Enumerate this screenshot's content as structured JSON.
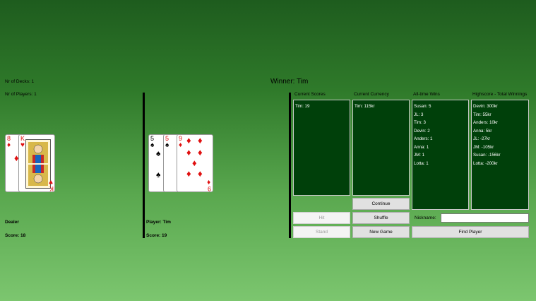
{
  "info": {
    "decks": "Nr of Decks: 1",
    "players": "Nr of Players: 1"
  },
  "winner": "Winner: Tim",
  "dealer": {
    "name": "Dealer",
    "score": "Score: 18",
    "cards": [
      {
        "rank": "8",
        "suit": "diamonds"
      },
      {
        "rank": "K",
        "suit": "hearts"
      }
    ]
  },
  "player": {
    "name": "Player: Tim",
    "score": "Score: 19",
    "cards": [
      {
        "rank": "5",
        "suit": "spades"
      },
      {
        "rank": "5",
        "suit": "spades"
      },
      {
        "rank": "9",
        "suit": "diamonds"
      }
    ]
  },
  "panels": {
    "current_scores": {
      "title": "Current Scores",
      "rows": [
        "Tim:  19"
      ]
    },
    "current_currency": {
      "title": "Current Currency",
      "rows": [
        "Tim:  115kr"
      ]
    },
    "alltime_wins": {
      "title": "All-time Wins",
      "rows": [
        "Susan:  5",
        "JL:  3",
        "Tim:  3",
        "Devin:  2",
        "Anders:  1",
        "Anna:  1",
        "JM:  1",
        "Lotta:  1"
      ]
    },
    "highscore": {
      "title": "Highscore - Total Winnings",
      "rows": [
        "Devin:  300kr",
        "Tim:  55kr",
        "Anders:  10kr",
        "Anna:  5kr",
        "JL:  -27kr",
        "JM:  -105kr",
        "Susan:  -156kr",
        "Lotta:  -200kr"
      ]
    }
  },
  "buttons": {
    "continue": "Continue",
    "hit": "Hit",
    "shuffle": "Shuffle",
    "stand": "Stand",
    "new_game": "New Game",
    "find_player": "Find Player"
  },
  "nickname": {
    "label": "Nickname:",
    "value": ""
  }
}
